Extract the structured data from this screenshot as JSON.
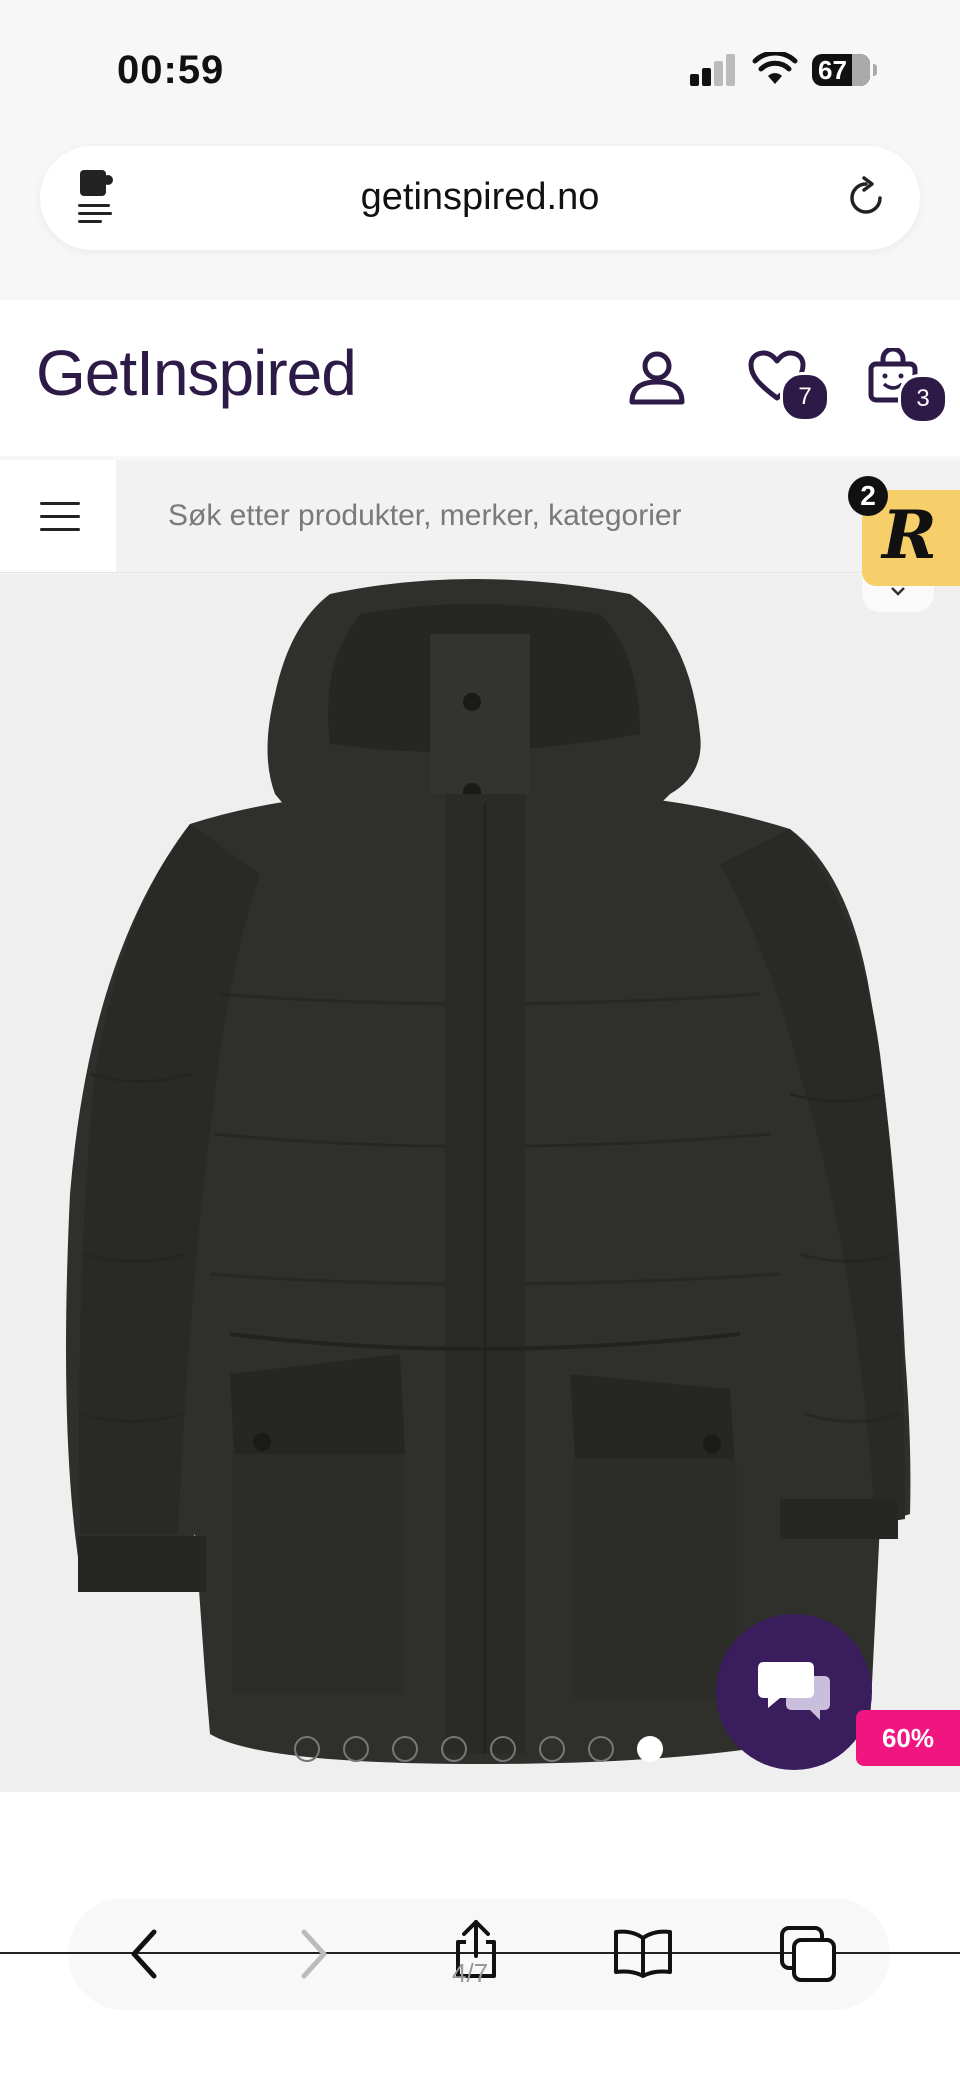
{
  "status_bar": {
    "time": "00:59",
    "battery": "67"
  },
  "browser": {
    "url": "getinspired.no",
    "page_count": "4/7"
  },
  "site": {
    "logo": "GetInspired",
    "wishlist_count": "7",
    "cart_count": "3",
    "search_placeholder": "Søk etter produkter, merker, kategorier"
  },
  "widget": {
    "letter": "R",
    "badge": "2"
  },
  "product": {
    "discount": "60%",
    "image_count": 8,
    "active_image": 8
  },
  "colors": {
    "brand": "#2e1a47",
    "discount": "#f0157f",
    "widget": "#f7cf6a"
  }
}
